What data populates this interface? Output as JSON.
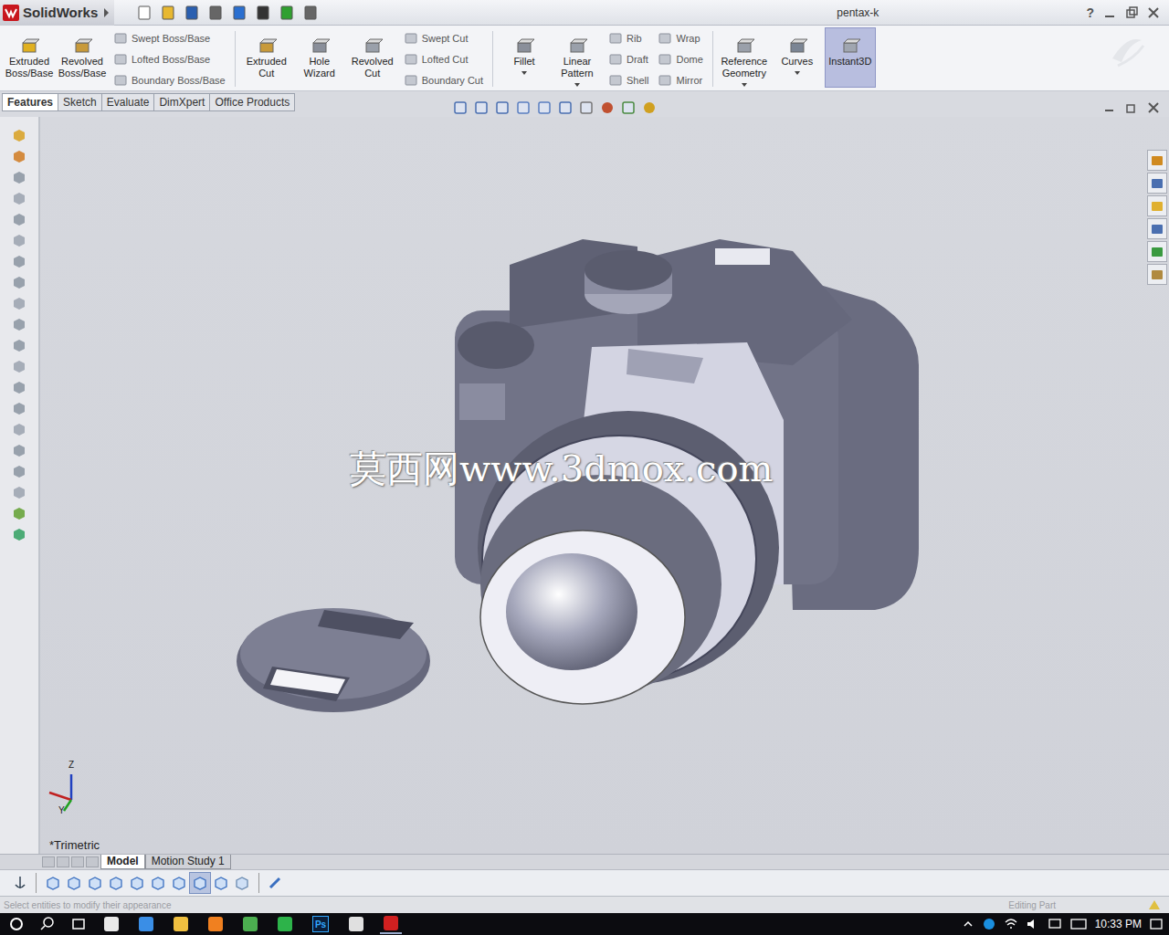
{
  "window": {
    "app": "SolidWorks",
    "title": "pentax-k",
    "help": "?"
  },
  "ribbon": {
    "groups": [
      {
        "items": [
          {
            "kind": "large",
            "label": "Extruded Boss/Base",
            "selected": false,
            "dropdown": false
          },
          {
            "kind": "large",
            "label": "Revolved Boss/Base",
            "selected": false,
            "dropdown": false
          },
          {
            "kind": "stack",
            "items": [
              {
                "label": "Swept Boss/Base",
                "selected": false
              },
              {
                "label": "Lofted Boss/Base",
                "selected": false
              },
              {
                "label": "Boundary Boss/Base",
                "selected": false
              }
            ]
          }
        ]
      },
      {
        "items": [
          {
            "kind": "large",
            "label": "Extruded Cut",
            "selected": false,
            "dropdown": false
          },
          {
            "kind": "large",
            "label": "Hole Wizard",
            "selected": false,
            "dropdown": false
          },
          {
            "kind": "large",
            "label": "Revolved Cut",
            "selected": false,
            "dropdown": false
          },
          {
            "kind": "stack",
            "items": [
              {
                "label": "Swept Cut",
                "selected": false
              },
              {
                "label": "Lofted Cut",
                "selected": false
              },
              {
                "label": "Boundary Cut",
                "selected": false
              }
            ]
          }
        ]
      },
      {
        "items": [
          {
            "kind": "large",
            "label": "Fillet",
            "selected": false,
            "dropdown": true
          },
          {
            "kind": "large",
            "label": "Linear Pattern",
            "selected": false,
            "dropdown": true
          },
          {
            "kind": "stack",
            "items": [
              {
                "label": "Rib",
                "selected": false
              },
              {
                "label": "Draft",
                "selected": false
              },
              {
                "label": "Shell",
                "selected": false
              }
            ]
          },
          {
            "kind": "stack",
            "items": [
              {
                "label": "Wrap",
                "selected": false
              },
              {
                "label": "Dome",
                "selected": false
              },
              {
                "label": "Mirror",
                "selected": false
              }
            ]
          }
        ]
      },
      {
        "items": [
          {
            "kind": "large",
            "label": "Reference Geometry",
            "selected": false,
            "dropdown": true
          },
          {
            "kind": "large",
            "label": "Curves",
            "selected": false,
            "dropdown": true
          },
          {
            "kind": "large",
            "label": "Instant3D",
            "selected": true,
            "dropdown": false
          }
        ]
      }
    ]
  },
  "tabs": [
    {
      "label": "Features",
      "selected": true
    },
    {
      "label": "Sketch",
      "selected": false
    },
    {
      "label": "Evaluate",
      "selected": false
    },
    {
      "label": "DimXpert",
      "selected": false
    },
    {
      "label": "Office Products",
      "selected": false
    }
  ],
  "viewport": {
    "view": "*Trimetric",
    "watermark": "莫西网www.3dmox.com",
    "triad": [
      "Z",
      "Y"
    ]
  },
  "bottom_tabs": [
    {
      "label": "Model",
      "selected": true
    },
    {
      "label": "Motion Study 1",
      "selected": false
    }
  ],
  "status_bar": {
    "message": "Select entities to modify their appearance",
    "mode": "Editing Part"
  },
  "taskbar": {
    "photoshop_label": "Ps",
    "time": "10:33 PM"
  }
}
